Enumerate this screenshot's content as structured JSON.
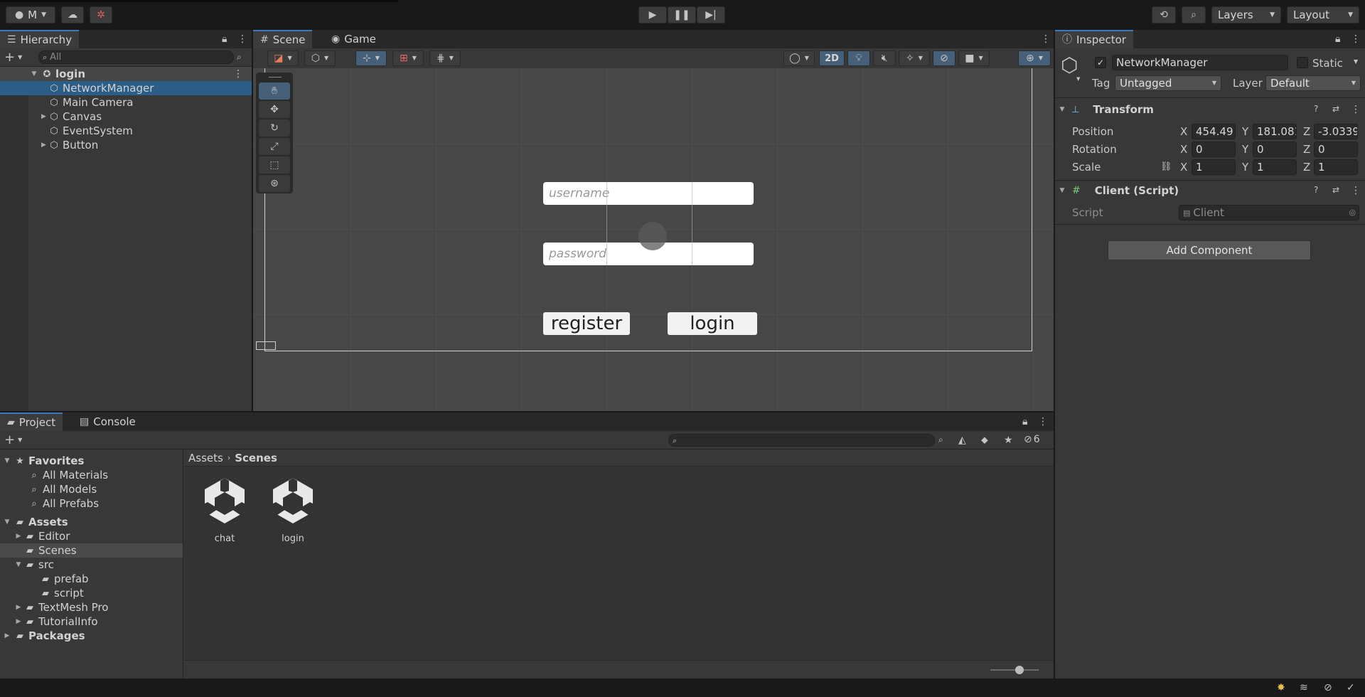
{
  "toolbar": {
    "account_label": "M",
    "layers_label": "Layers",
    "layout_label": "Layout"
  },
  "hierarchy": {
    "tab_label": "Hierarchy",
    "search_placeholder": "All",
    "scene_name": "login",
    "items": [
      {
        "label": "NetworkManager",
        "selected": true,
        "expandable": false
      },
      {
        "label": "Main Camera",
        "selected": false,
        "expandable": false
      },
      {
        "label": "Canvas",
        "selected": false,
        "expandable": true
      },
      {
        "label": "EventSystem",
        "selected": false,
        "expandable": false
      },
      {
        "label": "Button",
        "selected": false,
        "expandable": true
      }
    ]
  },
  "scene": {
    "tabs": {
      "scene": "Scene",
      "game": "Game"
    },
    "mode_2d": "2D",
    "ui": {
      "username_placeholder": "username",
      "password_placeholder": "password",
      "register_label": "register",
      "login_label": "login"
    }
  },
  "inspector": {
    "tab_label": "Inspector",
    "object_name": "NetworkManager",
    "static_label": "Static",
    "tag_label": "Tag",
    "tag_value": "Untagged",
    "layer_label": "Layer",
    "layer_value": "Default",
    "transform": {
      "title": "Transform",
      "position_label": "Position",
      "rotation_label": "Rotation",
      "scale_label": "Scale",
      "axis_x": "X",
      "axis_y": "Y",
      "axis_z": "Z",
      "position": {
        "x": "454.49",
        "y": "181.081",
        "z": "-3.0339"
      },
      "rotation": {
        "x": "0",
        "y": "0",
        "z": "0"
      },
      "scale": {
        "x": "1",
        "y": "1",
        "z": "1"
      }
    },
    "client_script": {
      "title": "Client (Script)",
      "script_label": "Script",
      "script_value": "Client"
    },
    "add_component_label": "Add Component"
  },
  "project": {
    "tabs": {
      "project": "Project",
      "console": "Console"
    },
    "hidden_count": "6",
    "favorites": {
      "label": "Favorites",
      "items": [
        "All Materials",
        "All Models",
        "All Prefabs"
      ]
    },
    "assets_label": "Assets",
    "tree": {
      "editor": "Editor",
      "scenes": "Scenes",
      "src": "src",
      "prefab": "prefab",
      "script": "script",
      "textmesh": "TextMesh Pro",
      "tutorial": "TutorialInfo",
      "packages": "Packages"
    },
    "breadcrumb": {
      "root": "Assets",
      "current": "Scenes"
    },
    "files": [
      {
        "name": "chat"
      },
      {
        "name": "login"
      }
    ]
  },
  "colors": {
    "selection": "#2c5d87",
    "accent_tab": "#3a79bb",
    "panel_bg": "#383838",
    "scene_bg": "#474747"
  }
}
